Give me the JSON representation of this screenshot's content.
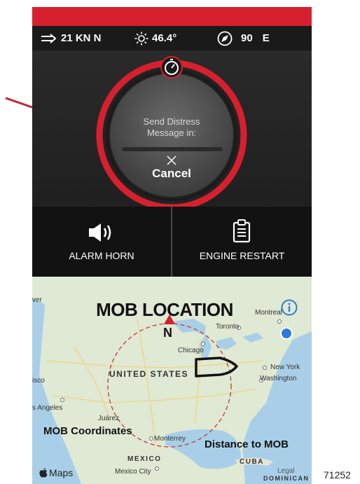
{
  "status": {
    "wind": "21 KN N",
    "temperature": "46.4°",
    "heading_value": "90",
    "heading_dir": "E"
  },
  "distress": {
    "line1": "Send Distress",
    "line2": "Message in:",
    "cancel_label": "Cancel"
  },
  "actions": {
    "alarm_label": "ALARM HORN",
    "engine_label": "ENGINE RESTART"
  },
  "map": {
    "title": "MOB LOCATION",
    "north": "N",
    "mob_coordinates": "MOB Coordinates",
    "distance_to_mob": "Distance to MOB",
    "attribution": "Maps",
    "places": {
      "toronto": "Toronto",
      "montreal": "Montreal",
      "chicago": "Chicago",
      "united_states": "UNITED STATES",
      "new_york": "New York",
      "washington": "Washington",
      "francisco": "isco",
      "vancouver": "ver",
      "los_angeles": "s Angeles",
      "juarez": "Juárez",
      "monterrey": "Monterrey",
      "mexico": "MEXICO",
      "mexico_city": "Mexico City",
      "cuba": "CUBA",
      "legal": "Legal",
      "dominican": "DOMINICAN"
    }
  },
  "figure_number": "71252",
  "colors": {
    "accent_red": "#d6202e",
    "screen_bg": "#111111",
    "map_land": "#dfe9d4",
    "map_water": "#a9cfe8",
    "info_blue": "#2f7bd8"
  }
}
